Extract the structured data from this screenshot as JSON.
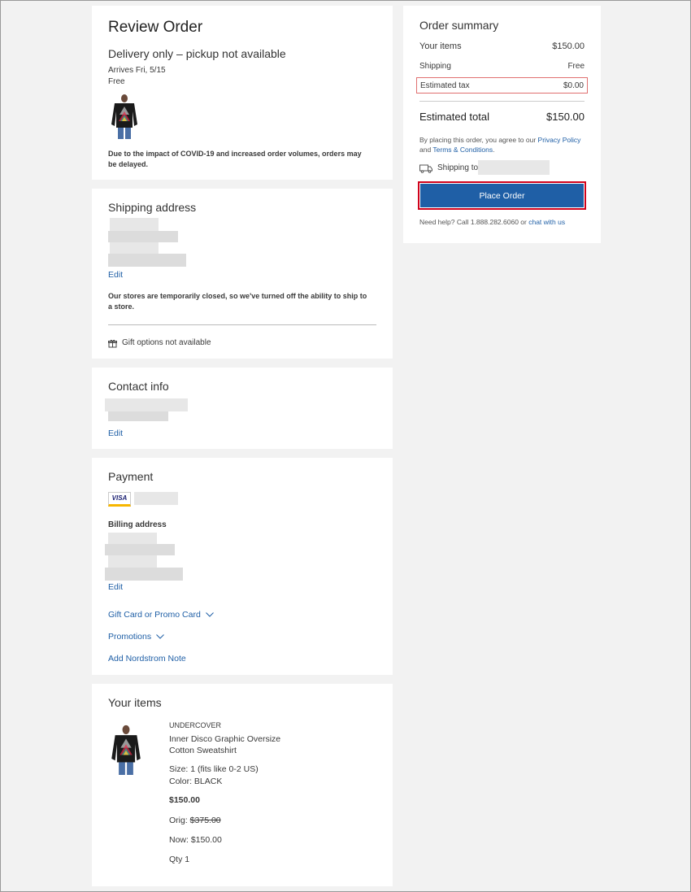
{
  "review": {
    "title": "Review Order",
    "delivery_heading": "Delivery only – pickup not available",
    "arrives": "Arrives Fri, 5/15",
    "shipping_cost": "Free",
    "covid_notice": "Due to the impact of COVID-19 and increased order volumes, orders may be delayed."
  },
  "shipping_address": {
    "title": "Shipping address",
    "edit": "Edit",
    "stores_notice": "Our stores are temporarily closed, so we've turned off the ability to ship to a store.",
    "gift_options": "Gift options not available"
  },
  "contact": {
    "title": "Contact info",
    "edit": "Edit"
  },
  "payment": {
    "title": "Payment",
    "card_brand": "VISA",
    "billing_label": "Billing address",
    "edit": "Edit",
    "gift_card": "Gift Card or Promo Card",
    "promotions": "Promotions",
    "add_note": "Add Nordstrom Note"
  },
  "items": {
    "title": "Your items",
    "brand": "UNDERCOVER",
    "name": "Inner Disco Graphic Oversize Cotton Sweatshirt",
    "size": "Size: 1 (fits like 0-2 US)",
    "color": "Color: BLACK",
    "price": "$150.00",
    "orig_label": "Orig: ",
    "orig_price": "$375.00",
    "now": "Now: $150.00",
    "qty": "Qty 1"
  },
  "summary": {
    "title": "Order summary",
    "items_label": "Your items",
    "items_value": "$150.00",
    "shipping_label": "Shipping",
    "shipping_value": "Free",
    "tax_label": "Estimated tax",
    "tax_value": "$0.00",
    "total_label": "Estimated total",
    "total_value": "$150.00",
    "agree_prefix": "By placing this order, you agree to our ",
    "privacy_link": "Privacy Policy",
    "agree_and": " and ",
    "terms_link": "Terms & Conditions",
    "agree_suffix": ".",
    "shipping_to": "Shipping to",
    "place_order": "Place Order",
    "help_prefix": "Need help? Call 1.888.282.6060 or ",
    "chat_link": "chat with us"
  },
  "colors": {
    "primary_button": "#1f5fa6",
    "highlight_border": "#d0021b",
    "link": "#1f5fa6"
  },
  "icons": {
    "gift": "gift-icon",
    "truck": "truck-icon",
    "chevron": "chevron-down-icon"
  }
}
